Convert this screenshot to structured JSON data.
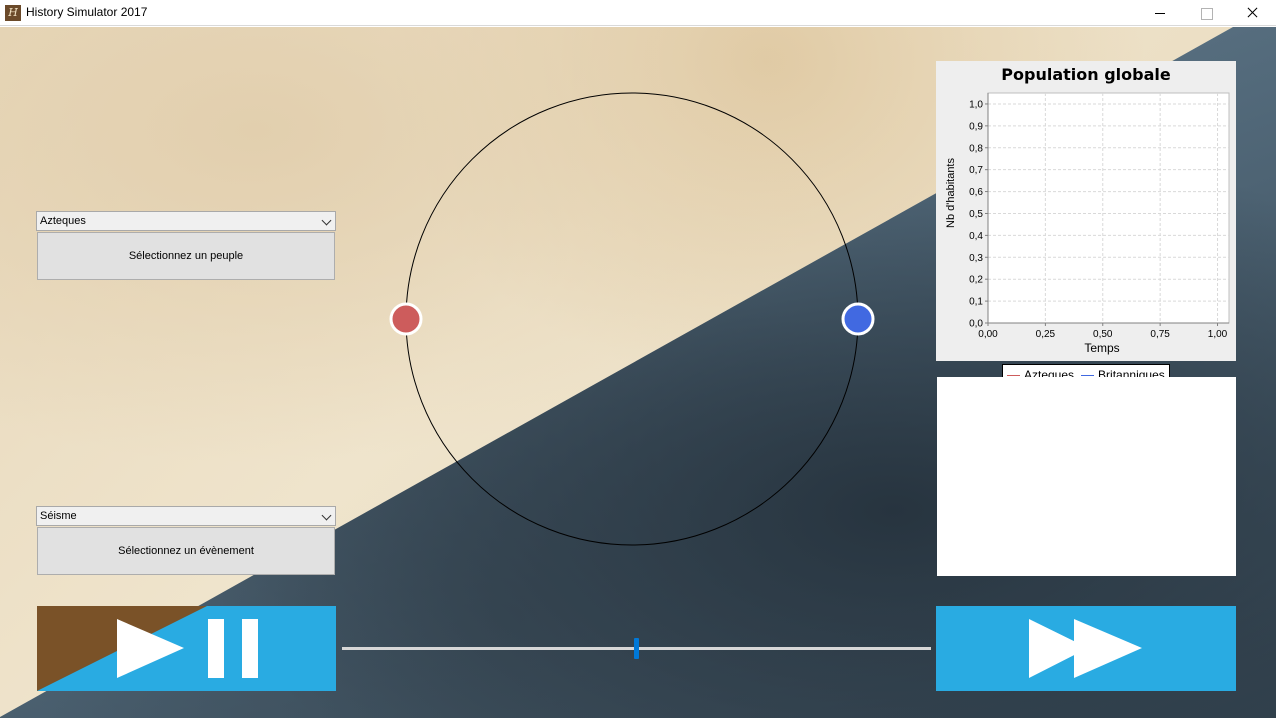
{
  "window": {
    "title": "History Simulator 2017",
    "icon_letter": "H"
  },
  "controls": {
    "people_combo": {
      "value": "Azteques"
    },
    "people_button": {
      "label": "Sélectionnez un peuple"
    },
    "event_combo": {
      "value": "Séisme"
    },
    "event_button": {
      "label": "Sélectionnez un évènement"
    },
    "speed_slider": {
      "value_fraction": 0.5
    }
  },
  "simulation": {
    "nodes": [
      {
        "name": "Azteques",
        "color": "#cd5c5c"
      },
      {
        "name": "Britanniques",
        "color": "#4169e1"
      }
    ]
  },
  "colors": {
    "accent_blue": "#29abe2",
    "play_brown": "#7a5228",
    "slider_thumb": "#0078d7"
  },
  "chart_data": {
    "type": "line",
    "title": "Population globale",
    "xlabel": "Temps",
    "ylabel": "Nb d'habitants",
    "xlim": [
      0,
      1.05
    ],
    "ylim": [
      0,
      1.05
    ],
    "xticks": [
      "0,00",
      "0,25",
      "0,50",
      "0,75",
      "1,00"
    ],
    "yticks": [
      "0,0",
      "0,1",
      "0,2",
      "0,3",
      "0,4",
      "0,5",
      "0,6",
      "0,7",
      "0,8",
      "0,9",
      "1,0"
    ],
    "grid": true,
    "legend_position": "bottom",
    "series": [
      {
        "name": "Azteques",
        "color": "#cd5c5c",
        "x": [],
        "y": []
      },
      {
        "name": "Britanniques",
        "color": "#4169e1",
        "x": [],
        "y": []
      }
    ]
  }
}
